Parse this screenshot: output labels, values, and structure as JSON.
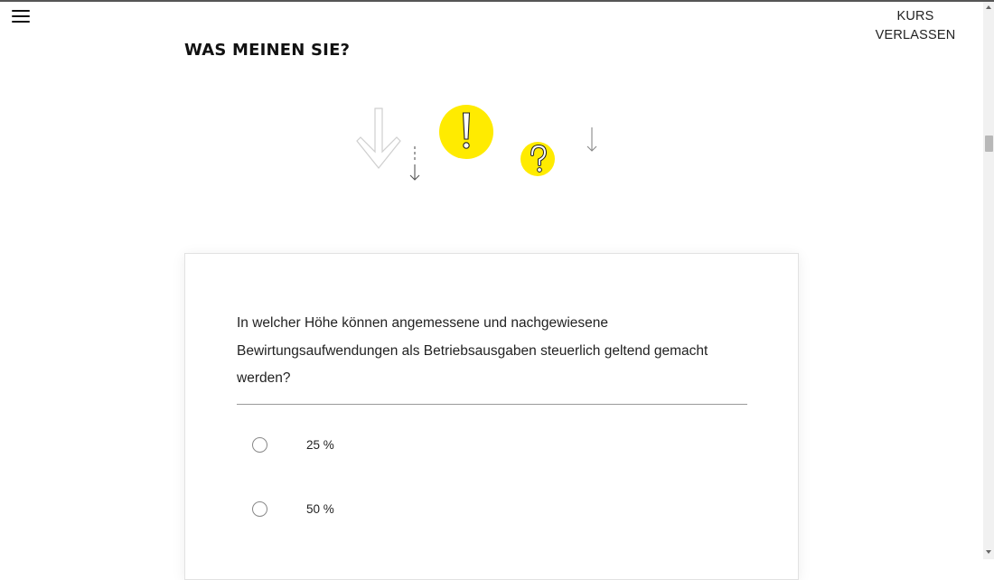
{
  "header": {
    "exit_label_line1": "KURS",
    "exit_label_line2": "VERLASSEN"
  },
  "section": {
    "title": "WAS MEINEN SIE?"
  },
  "illustration": {
    "icons": [
      "arrow-down-icon",
      "exclamation-icon",
      "question-mark-icon"
    ],
    "accent_color": "#FFEB00"
  },
  "quiz": {
    "question": "In welcher Höhe können angemessene und nachgewiesene Bewirtungsaufwendungen als Betriebsausgaben steuerlich geltend gemacht werden?",
    "options": [
      {
        "label": "25 %",
        "selected": false
      },
      {
        "label": "50 %",
        "selected": false
      }
    ]
  }
}
